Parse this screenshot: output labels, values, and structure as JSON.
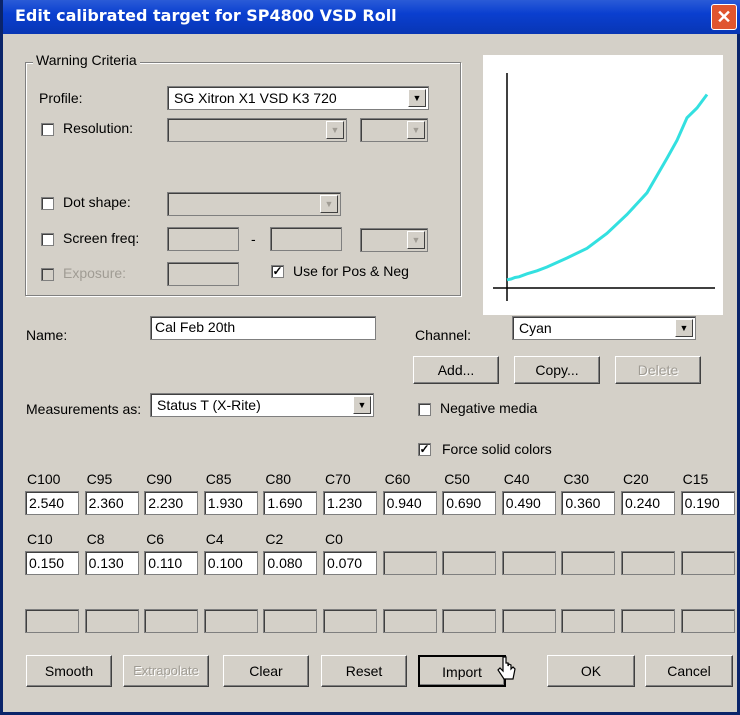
{
  "window": {
    "title": "Edit calibrated target for SP4800 VSD Roll",
    "close_label": "✕"
  },
  "warning": {
    "group_label": "Warning Criteria",
    "profile_label": "Profile:",
    "profile_value": "SG  Xitron X1 VSD K3 720",
    "resolution_label": "Resolution:",
    "dot_shape_label": "Dot shape:",
    "screen_freq_label": "Screen freq:",
    "screen_freq_sep": "-",
    "exposure_label": "Exposure:",
    "use_pos_neg_label": "Use for Pos & Neg",
    "use_pos_neg_checked": true
  },
  "name_label": "Name:",
  "name_value": "Cal Feb 20th",
  "channel_label": "Channel:",
  "channel_value": "Cyan",
  "buttons_top": {
    "add": "Add...",
    "copy": "Copy...",
    "delete": "Delete"
  },
  "measurements_label": "Measurements as:",
  "measurements_value": "Status T (X-Rite)",
  "negative_media_label": "Negative media",
  "negative_media_checked": false,
  "force_solid_label": "Force solid colors",
  "force_solid_checked": true,
  "grid": {
    "row1_headers": [
      "C100",
      "C95",
      "C90",
      "C85",
      "C80",
      "C70",
      "C60",
      "C50",
      "C40",
      "C30",
      "C20",
      "C15"
    ],
    "row1_values": [
      "2.540",
      "2.360",
      "2.230",
      "1.930",
      "1.690",
      "1.230",
      "0.940",
      "0.690",
      "0.490",
      "0.360",
      "0.240",
      "0.190"
    ],
    "row2_headers": [
      "C10",
      "C8",
      "C6",
      "C4",
      "C2",
      "C0"
    ],
    "row2_values": [
      "0.150",
      "0.130",
      "0.110",
      "0.100",
      "0.080",
      "0.070"
    ]
  },
  "buttons_bottom": {
    "smooth": "Smooth",
    "extrapolate": "Extrapolate",
    "clear": "Clear",
    "reset": "Reset",
    "import": "Import",
    "ok": "OK",
    "cancel": "Cancel"
  },
  "chart_data": {
    "type": "line",
    "series": [
      {
        "color": "#33e0e0",
        "x": [
          0,
          2,
          4,
          6,
          8,
          10,
          15,
          20,
          30,
          40,
          50,
          60,
          70,
          80,
          85,
          90,
          95,
          100
        ],
        "y": [
          0.07,
          0.08,
          0.1,
          0.11,
          0.13,
          0.15,
          0.19,
          0.24,
          0.36,
          0.49,
          0.69,
          0.94,
          1.23,
          1.69,
          1.93,
          2.23,
          2.36,
          2.54
        ]
      }
    ],
    "xlim": [
      0,
      100
    ],
    "ylim": [
      0,
      2.8
    ],
    "grid": false
  }
}
